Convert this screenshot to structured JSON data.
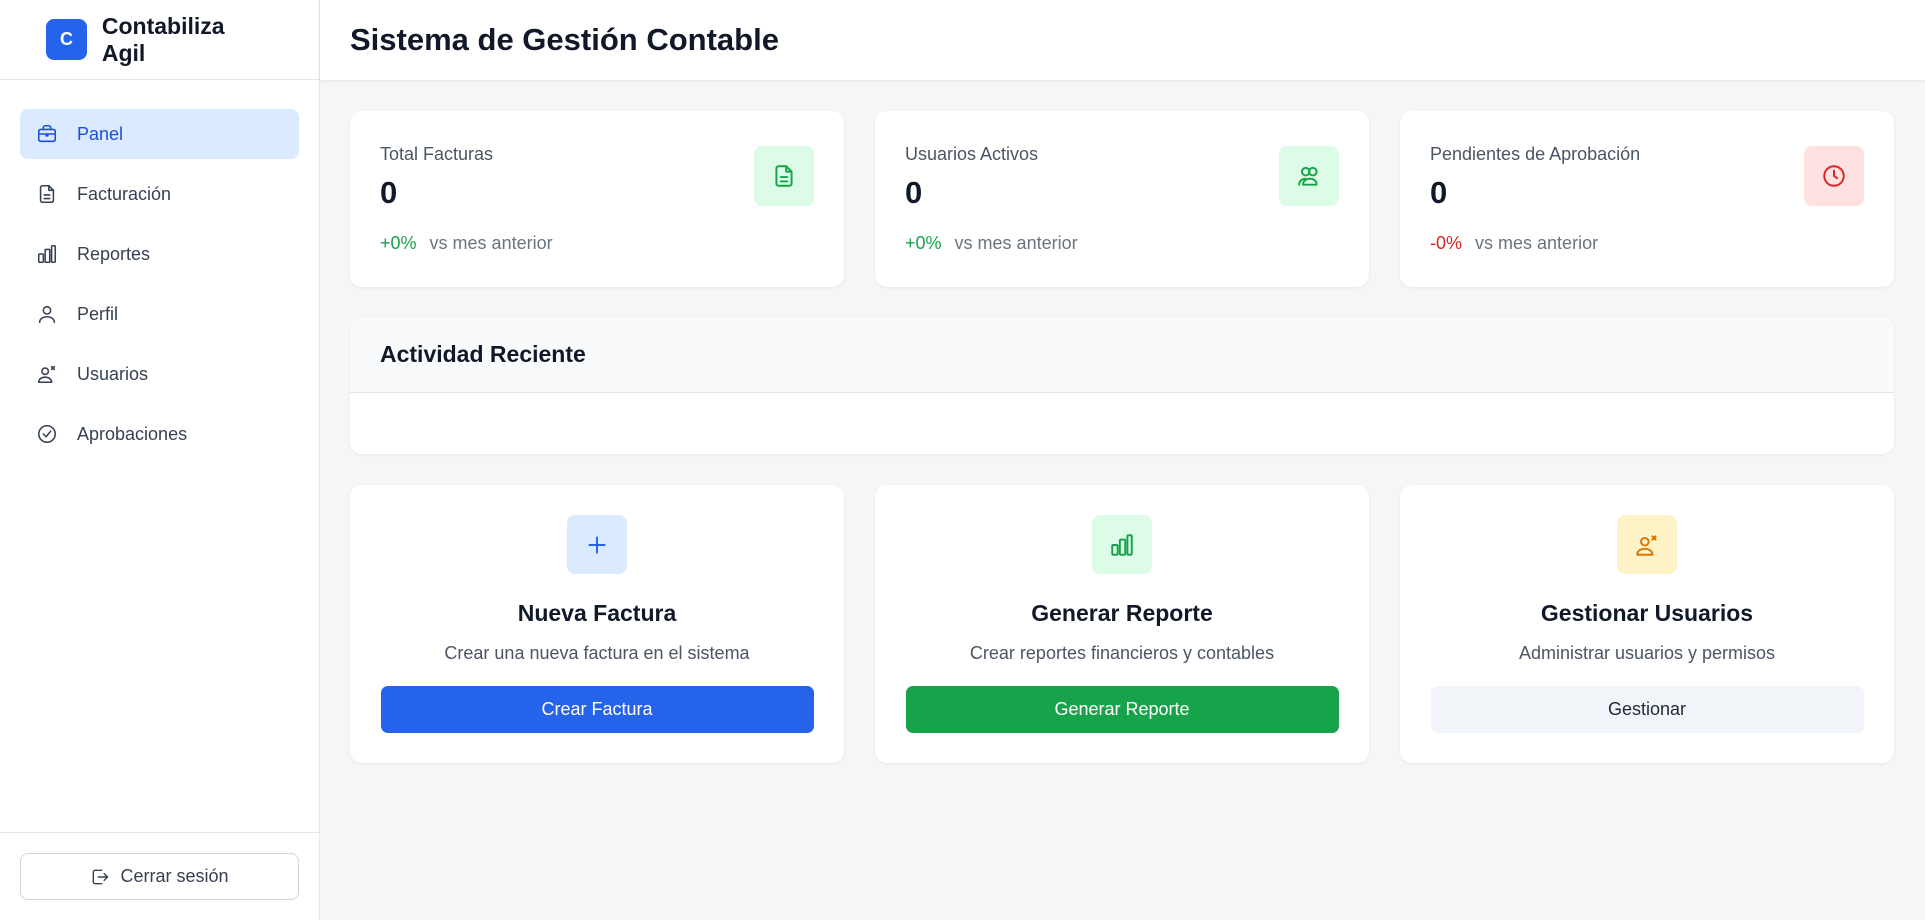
{
  "brand": {
    "logo_letter": "C",
    "name": "Contabiliza Agil"
  },
  "sidebar": {
    "items": [
      {
        "label": "Panel",
        "icon": "briefcase-icon",
        "active": true
      },
      {
        "label": "Facturación",
        "icon": "document-icon"
      },
      {
        "label": "Reportes",
        "icon": "bar-chart-icon"
      },
      {
        "label": "Perfil",
        "icon": "user-icon"
      },
      {
        "label": "Usuarios",
        "icon": "user-cog-icon"
      },
      {
        "label": "Aprobaciones",
        "icon": "check-circle-icon"
      }
    ],
    "logout_label": "Cerrar sesión"
  },
  "header": {
    "title": "Sistema de Gestión Contable"
  },
  "stats": [
    {
      "label": "Total Facturas",
      "value": "0",
      "delta": "+0%",
      "compare": "vs mes anterior",
      "icon": "document-icon",
      "color": "#16a34a"
    },
    {
      "label": "Usuarios Activos",
      "value": "0",
      "delta": "+0%",
      "compare": "vs mes anterior",
      "icon": "users-icon",
      "color": "#16a34a"
    },
    {
      "label": "Pendientes de Aprobación",
      "value": "0",
      "delta": "-0%",
      "compare": "vs mes anterior",
      "icon": "clock-icon",
      "color": "#dc2626"
    }
  ],
  "activity": {
    "title": "Actividad Reciente"
  },
  "actions": [
    {
      "title": "Nueva Factura",
      "description": "Crear una nueva factura en el sistema",
      "button": "Crear Factura",
      "icon": "plus-icon",
      "color": "#2563eb"
    },
    {
      "title": "Generar Reporte",
      "description": "Crear reportes financieros y contables",
      "button": "Generar Reporte",
      "icon": "bar-chart-icon",
      "color": "#16a34a"
    },
    {
      "title": "Gestionar Usuarios",
      "description": "Administrar usuarios y permisos",
      "button": "Gestionar",
      "icon": "user-cog-icon",
      "color": "#d97706"
    }
  ]
}
